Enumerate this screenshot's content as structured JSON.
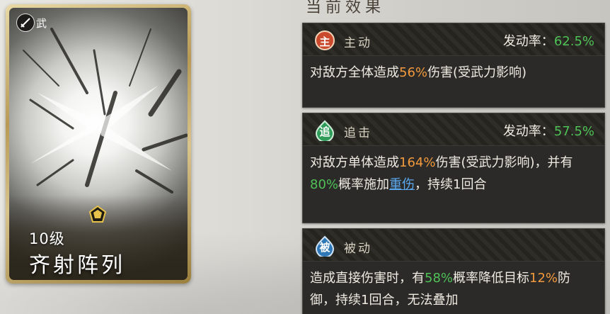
{
  "card": {
    "type_label": "武",
    "level": "10级",
    "name": "齐射阵列",
    "type_icon": "sword-icon",
    "gem_icon": "gem-icon"
  },
  "panel_title": "当前效果",
  "skills": [
    {
      "badge": "主",
      "badge_color": "#c94a2c",
      "kind": "主动",
      "rate_label": "发动率：",
      "rate": "62.5%",
      "desc": [
        {
          "t": "对敌方全体造成"
        },
        {
          "t": "56%",
          "c": "orange"
        },
        {
          "t": "伤害(受武力影响)"
        }
      ]
    },
    {
      "badge": "追",
      "badge_color": "#2f9c5a",
      "kind": "追击",
      "rate_label": "发动率：",
      "rate": "57.5%",
      "desc": [
        {
          "t": "对敌方单体造成"
        },
        {
          "t": "164%",
          "c": "orange"
        },
        {
          "t": "伤害(受武力影响)，并有"
        },
        {
          "t": "80%",
          "c": "green"
        },
        {
          "t": "概率施加"
        },
        {
          "t": "重伤",
          "c": "link"
        },
        {
          "t": "，持续1回合"
        }
      ]
    },
    {
      "badge": "被",
      "badge_color": "#2f78b8",
      "kind": "被动",
      "desc": [
        {
          "t": "造成直接伤害时，有"
        },
        {
          "t": "58%",
          "c": "green"
        },
        {
          "t": "概率降低目标"
        },
        {
          "t": "12%",
          "c": "orange"
        },
        {
          "t": "防御，持续1回合，无法叠加"
        }
      ]
    }
  ]
}
